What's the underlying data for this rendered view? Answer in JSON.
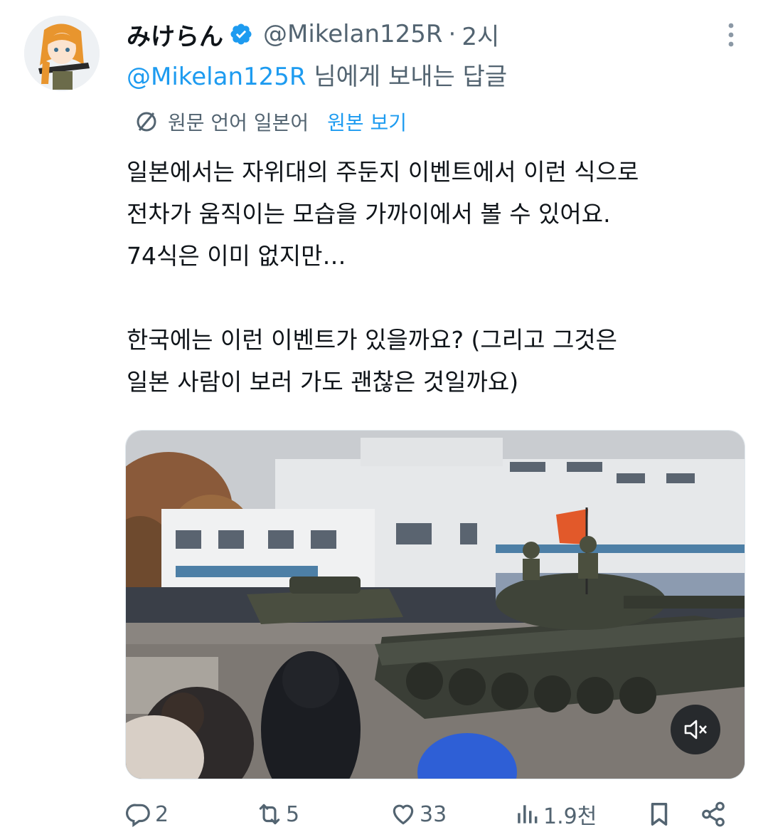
{
  "author": {
    "display_name": "みけらん",
    "handle": "@Mikelan125R",
    "separator": "·",
    "time": "2시",
    "verified_icon": "verified-badge-icon"
  },
  "reply": {
    "mention": "@Mikelan125R",
    "suffix": " 님에게 보내는 답글"
  },
  "translation": {
    "label": "원문 언어 일본어",
    "show_original": "원본 보기"
  },
  "tweet": {
    "lines": [
      "일본에서는 자위대의 주둔지 이벤트에서 이런 식으로",
      "전차가 움직이는 모습을 가까이에서 볼 수 있어요.",
      "74식은 이미 없지만…",
      "",
      "한국에는 이런 이벤트가 있을까요? (그리고 그것은",
      "일본 사람이 보러 가도 괜찮은 것일까요)"
    ]
  },
  "media": {
    "type": "video",
    "mute_icon": "speaker-muted-icon"
  },
  "actions": {
    "replies": "2",
    "reposts": "5",
    "likes": "33",
    "views": "1.9천"
  },
  "colors": {
    "accent": "#1d9bf0",
    "secondary_text": "#536471",
    "primary_text": "#0f1419"
  }
}
